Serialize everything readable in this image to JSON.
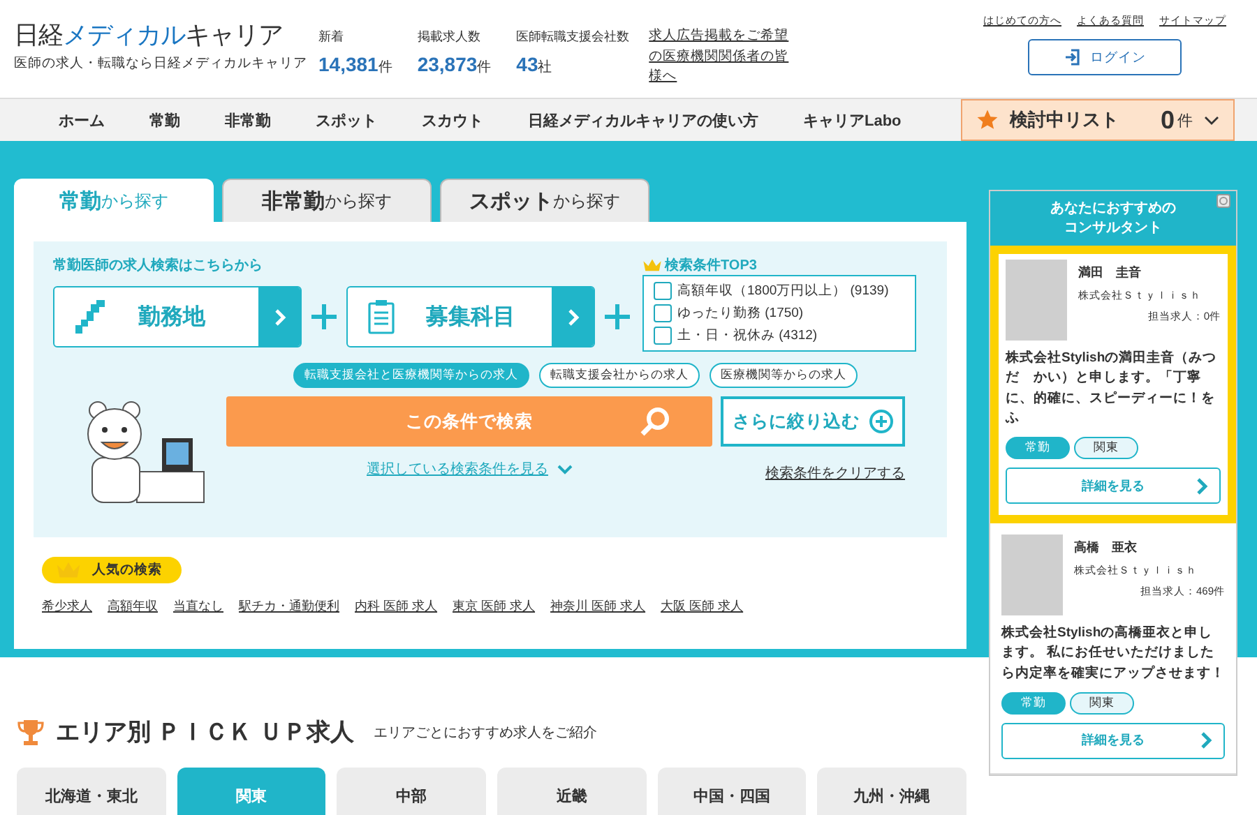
{
  "header": {
    "logo": [
      {
        "text": "日経",
        "accent": false
      },
      {
        "text": "メディカル",
        "accent": true
      },
      {
        "text": "キャリア",
        "accent": false
      }
    ],
    "tagline": "医師の求人・転職なら日経メディカルキャリア",
    "stats": [
      {
        "label": "新着",
        "value": "14,381",
        "unit": "件"
      },
      {
        "label": "掲載求人数",
        "value": "23,873",
        "unit": "件"
      },
      {
        "label": "医師転職支援会社数",
        "value": "43",
        "unit": "社"
      }
    ],
    "ad_link": "求人広告掲載をご希望の医療機関関係者の皆様へ",
    "top_links": [
      "はじめての方へ",
      "よくある質問",
      "サイトマップ"
    ],
    "login_button": "ログイン"
  },
  "nav": {
    "items": [
      "ホーム",
      "常勤",
      "非常勤",
      "スポット",
      "スカウト",
      "日経メディカルキャリアの使い方",
      "キャリアLabo"
    ],
    "watchlist": {
      "label": "検討中リスト",
      "count": "0",
      "unit": "件"
    }
  },
  "search": {
    "tabs": [
      {
        "label": "**常勤**から探す",
        "selected": true
      },
      {
        "label": "**非常勤**から探す",
        "selected": false
      },
      {
        "label": "**スポット**から探す",
        "selected": false
      }
    ],
    "heading": "常勤医師の求人検索はこちらから",
    "selectors": [
      {
        "label": "勤務地",
        "kind": "location"
      },
      {
        "label": "募集科目",
        "kind": "specialty"
      }
    ],
    "top3": {
      "title": "検索条件TOP3",
      "items": [
        {
          "label": "高額年収（1800万円以上） (9139)",
          "checked": false
        },
        {
          "label": "ゆったり勤務 (1750)",
          "checked": false
        },
        {
          "label": "土・日・祝休み (4312)",
          "checked": false
        }
      ]
    },
    "sources": [
      {
        "label": "転職支援会社と医療機関等からの求人",
        "selected": true
      },
      {
        "label": "転職支援会社からの求人",
        "selected": false
      },
      {
        "label": "医療機関等からの求人",
        "selected": false
      }
    ],
    "search_button": "この条件で検索",
    "refine_button": "さらに絞り込む",
    "show_conditions_link": "選択している検索条件を見る",
    "clear_link": "検索条件をクリアする",
    "popular": {
      "badge": "人気の検索",
      "links": [
        "希少求人",
        "高額年収",
        "当直なし",
        "駅チカ・通勤便利",
        "内科 医師 求人",
        "東京 医師 求人",
        "神奈川 医師 求人",
        "大阪 医師 求人"
      ]
    }
  },
  "sidebar": {
    "title_lines": [
      "あなたにおすすめの",
      "コンサルタント"
    ],
    "consultants": [
      {
        "name": "満田　圭音",
        "company": "株式会社Ｓｔｙｌｉｓｈ",
        "jobs": "担当求人：0件",
        "intro": "株式会社Stylishの満田圭音（みつだ　かい）と申します。「丁寧に、的確に、スピーディーに！をふ",
        "tags": [
          {
            "label": "常勤",
            "selected": true
          },
          {
            "label": "関東",
            "selected": false
          }
        ],
        "button": "詳細を見る",
        "highlighted": true
      },
      {
        "name": "高橋　亜衣",
        "company": "株式会社Ｓｔｙｌｉｓｈ",
        "jobs": "担当求人：469件",
        "intro": "株式会社Stylishの高橋亜衣と申します。 私にお任せいただけましたら内定率を確実にアップさせます！",
        "tags": [
          {
            "label": "常勤",
            "selected": true
          },
          {
            "label": "関東",
            "selected": false
          }
        ],
        "button": "詳細を見る",
        "highlighted": false
      }
    ]
  },
  "area_section": {
    "title": "エリア別 ＰＩＣＫ ＵＰ求人",
    "subtitle": "エリアごとにおすすめ求人をご紹介",
    "tabs": [
      {
        "label": "北海道・東北",
        "selected": false
      },
      {
        "label": "関東",
        "selected": true
      },
      {
        "label": "中部",
        "selected": false
      },
      {
        "label": "近畿",
        "selected": false
      },
      {
        "label": "中国・四国",
        "selected": false
      },
      {
        "label": "九州・沖縄",
        "selected": false
      }
    ]
  }
}
